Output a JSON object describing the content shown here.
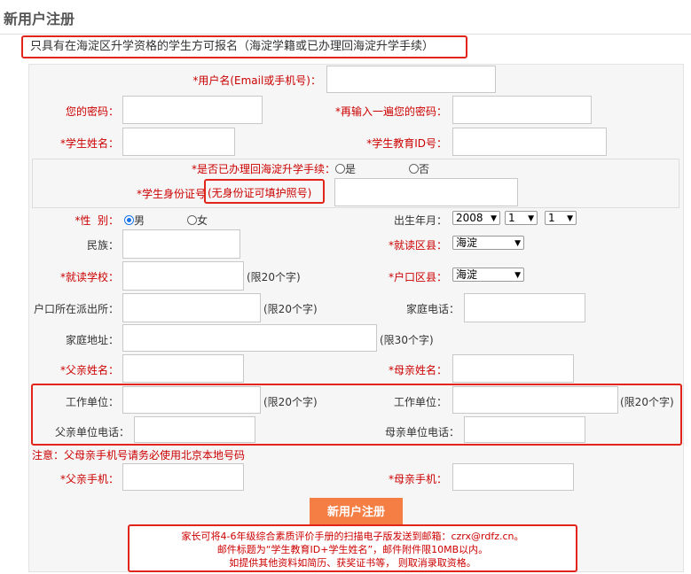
{
  "page_title": "新用户注册",
  "notice": "只具有在海淀区升学资格的学生方可报名（海淀学籍或已办理回海淀升学手续）",
  "labels": {
    "username": "*用户名(Email或手机号)：",
    "password": "您的密码：",
    "password_confirm": "*再输入一遍您的密码：",
    "student_name": "*学生姓名：",
    "student_edu_id": "*学生教育ID号：",
    "handled_return": "*是否已办理回海淀升学手续：",
    "student_id_card": "*学生身份证号",
    "id_card_hint": "(无身份证可填护照号)",
    "gender": "*性  别：",
    "birth": "出生年月：",
    "ethnicity": "民族：",
    "district": "*就读区县：",
    "school": "*就读学校：",
    "hukou_district": "*户口区县：",
    "police_station": "户口所在派出所：",
    "home_phone": "家庭电话：",
    "home_address": "家庭地址：",
    "father_name": "*父亲姓名：",
    "mother_name": "*母亲姓名：",
    "work_unit_father": "工作单位：",
    "work_unit_mother": "工作单位：",
    "father_work_phone": "父亲单位电话：",
    "mother_work_phone": "母亲单位电话：",
    "father_mobile": "*父亲手机：",
    "mother_mobile": "*母亲手机："
  },
  "options": {
    "yes": "是",
    "no": "否",
    "male": "男",
    "female": "女"
  },
  "selected": {
    "handled_return": "none",
    "gender": "male"
  },
  "limits": {
    "school": "(限20个字)",
    "police_station": "(限20个字)",
    "home_address": "(限30个字)",
    "work_unit_father": "(限20个字)",
    "work_unit_mother": "(限20个字)"
  },
  "selects": {
    "birth_year": "2008",
    "birth_month": "1",
    "birth_day": "1",
    "district": "海淀",
    "hukou_district": "海淀"
  },
  "warning": "注意：父母亲手机号请务必使用北京本地号码",
  "submit_label": "新用户注册",
  "info_lines": [
    "家长可将4-6年级综合素质评价手册的扫描电子版发送到邮箱：czrx@rdfz.cn。",
    "邮件标题为“学生教育ID+学生姓名”，邮件附件限10MB以内。",
    "如提供其他资料如简历、获奖证书等， 则取消录取资格。"
  ],
  "colors": {
    "required": "#cc0000",
    "highlight_border": "#e1251b",
    "submit_bg": "#f47e44"
  }
}
